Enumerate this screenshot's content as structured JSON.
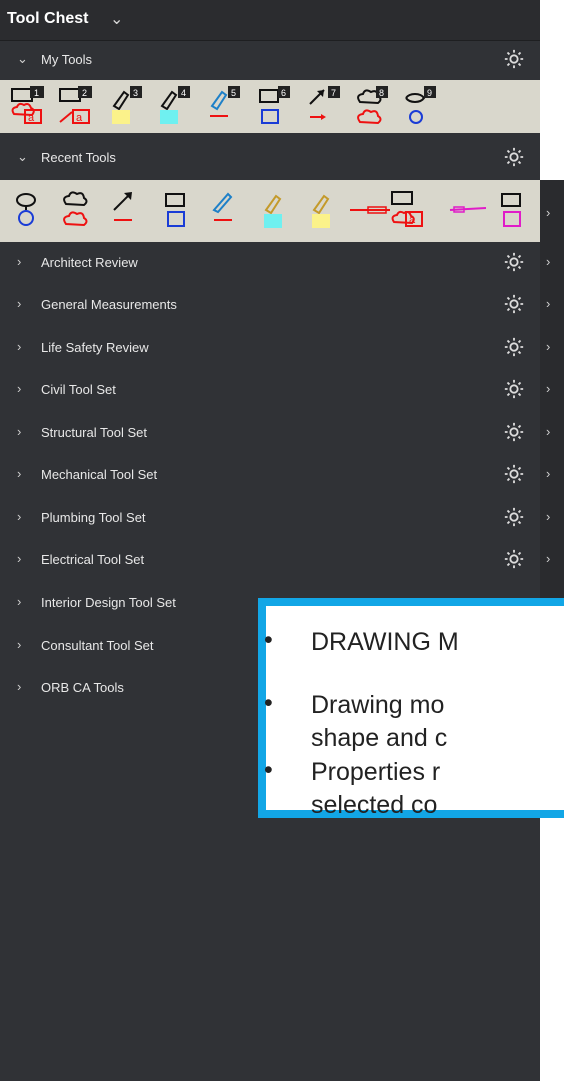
{
  "title": "Tool Chest",
  "my_tools": {
    "label": "My Tools"
  },
  "recent_tools": {
    "label": "Recent Tools"
  },
  "tool_sets": [
    {
      "label": "Architect Review"
    },
    {
      "label": "General Measurements"
    },
    {
      "label": "Life Safety Review"
    },
    {
      "label": "Civil Tool Set"
    },
    {
      "label": "Structural Tool Set"
    },
    {
      "label": "Mechanical Tool Set"
    },
    {
      "label": "Plumbing Tool Set"
    },
    {
      "label": "Electrical Tool Set"
    },
    {
      "label": "Interior Design Tool Set"
    },
    {
      "label": "Consultant Tool Set"
    },
    {
      "label": "ORB CA Tools"
    }
  ],
  "my_tool_badges": [
    "1",
    "2",
    "3",
    "4",
    "5",
    "6",
    "7",
    "8",
    "9"
  ],
  "popup": {
    "bullets": [
      {
        "line1": "DRAWING M",
        "line2": ""
      },
      {
        "line1": "Drawing mo",
        "line2": "shape and c"
      },
      {
        "line1": "Properties r",
        "line2": "selected co"
      }
    ]
  },
  "colors": {
    "panel": "#303236",
    "tray": "#d9d7cc",
    "popup_border": "#12a6e6"
  }
}
